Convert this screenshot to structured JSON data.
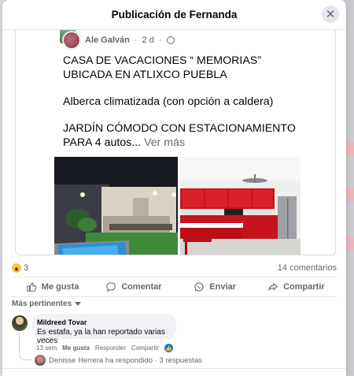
{
  "modal": {
    "title": "Publicación de Fernanda",
    "close_icon": "close-icon"
  },
  "post": {
    "author": "Ale Galván",
    "time": "2 d",
    "separator": "·",
    "privacy_icon": "globe-icon",
    "lines": {
      "l1": "CASA DE VACACIONES “ MEMORIAS”",
      "l2": "UBICADA EN ATLIXCO PUEBLA",
      "l3": "Alberca climatizada (con opción a caldera)",
      "l4": "JARDÍN CÓMODO CON ESTACIONAMIENTO",
      "l5": "PARA 4 autos...",
      "see_more": "Ver más"
    }
  },
  "reactions": {
    "icon": "wow-reaction-icon",
    "count": "3",
    "comments": "14 comentarios"
  },
  "actions": {
    "like": "Me gusta",
    "comment": "Comentar",
    "send": "Enviar",
    "share": "Compartir"
  },
  "filter": {
    "label": "Más pertinentes"
  },
  "comment": {
    "author": "Mildreed Tovar",
    "text": "Es estafa, ya la han reportado varias veces",
    "time": "13 sem",
    "like": "Me gusta",
    "reply": "Responder",
    "share": "Compartir",
    "reply_summary": "Denisse Herrera ha respondido · 3 respuestas"
  },
  "colors": {
    "accent": "#1877f2",
    "text_secondary": "#65676b",
    "bubble": "#f0f2f5"
  }
}
